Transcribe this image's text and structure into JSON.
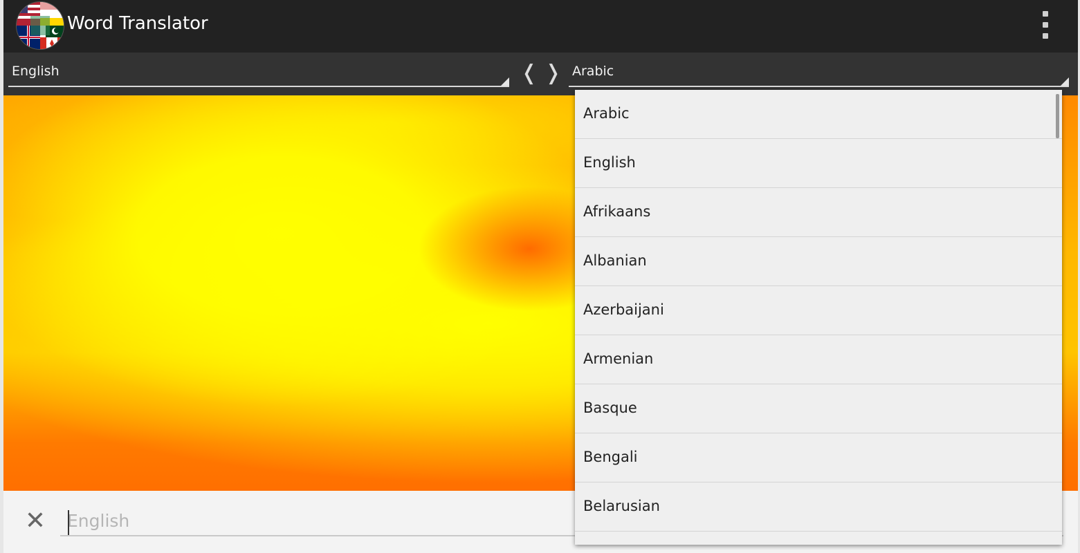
{
  "app": {
    "title": "Word Translator"
  },
  "source_language": {
    "selected": "English"
  },
  "target_language": {
    "selected": "Arabic"
  },
  "swap": {
    "symbol": "❬ ❭"
  },
  "input": {
    "placeholder": "English",
    "value": "",
    "clear_symbol": "✕"
  },
  "dropdown": {
    "items": [
      "Arabic",
      "English",
      "Afrikaans",
      "Albanian",
      "Azerbaijani",
      "Armenian",
      "Basque",
      "Bengali",
      "Belarusian"
    ]
  },
  "colors": {
    "actionbar": "#222222",
    "langbar": "#333333",
    "background_orange": "#ff7000",
    "background_yellow": "#ffff00",
    "dropdown_bg": "#efefef"
  }
}
